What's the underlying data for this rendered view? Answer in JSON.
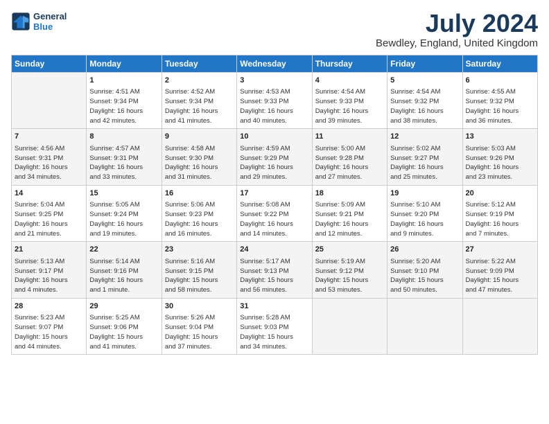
{
  "header": {
    "logo_line1": "General",
    "logo_line2": "Blue",
    "month": "July 2024",
    "location": "Bewdley, England, United Kingdom"
  },
  "weekdays": [
    "Sunday",
    "Monday",
    "Tuesday",
    "Wednesday",
    "Thursday",
    "Friday",
    "Saturday"
  ],
  "weeks": [
    [
      {
        "day": "",
        "info": ""
      },
      {
        "day": "1",
        "info": "Sunrise: 4:51 AM\nSunset: 9:34 PM\nDaylight: 16 hours\nand 42 minutes."
      },
      {
        "day": "2",
        "info": "Sunrise: 4:52 AM\nSunset: 9:34 PM\nDaylight: 16 hours\nand 41 minutes."
      },
      {
        "day": "3",
        "info": "Sunrise: 4:53 AM\nSunset: 9:33 PM\nDaylight: 16 hours\nand 40 minutes."
      },
      {
        "day": "4",
        "info": "Sunrise: 4:54 AM\nSunset: 9:33 PM\nDaylight: 16 hours\nand 39 minutes."
      },
      {
        "day": "5",
        "info": "Sunrise: 4:54 AM\nSunset: 9:32 PM\nDaylight: 16 hours\nand 38 minutes."
      },
      {
        "day": "6",
        "info": "Sunrise: 4:55 AM\nSunset: 9:32 PM\nDaylight: 16 hours\nand 36 minutes."
      }
    ],
    [
      {
        "day": "7",
        "info": "Sunrise: 4:56 AM\nSunset: 9:31 PM\nDaylight: 16 hours\nand 34 minutes."
      },
      {
        "day": "8",
        "info": "Sunrise: 4:57 AM\nSunset: 9:31 PM\nDaylight: 16 hours\nand 33 minutes."
      },
      {
        "day": "9",
        "info": "Sunrise: 4:58 AM\nSunset: 9:30 PM\nDaylight: 16 hours\nand 31 minutes."
      },
      {
        "day": "10",
        "info": "Sunrise: 4:59 AM\nSunset: 9:29 PM\nDaylight: 16 hours\nand 29 minutes."
      },
      {
        "day": "11",
        "info": "Sunrise: 5:00 AM\nSunset: 9:28 PM\nDaylight: 16 hours\nand 27 minutes."
      },
      {
        "day": "12",
        "info": "Sunrise: 5:02 AM\nSunset: 9:27 PM\nDaylight: 16 hours\nand 25 minutes."
      },
      {
        "day": "13",
        "info": "Sunrise: 5:03 AM\nSunset: 9:26 PM\nDaylight: 16 hours\nand 23 minutes."
      }
    ],
    [
      {
        "day": "14",
        "info": "Sunrise: 5:04 AM\nSunset: 9:25 PM\nDaylight: 16 hours\nand 21 minutes."
      },
      {
        "day": "15",
        "info": "Sunrise: 5:05 AM\nSunset: 9:24 PM\nDaylight: 16 hours\nand 19 minutes."
      },
      {
        "day": "16",
        "info": "Sunrise: 5:06 AM\nSunset: 9:23 PM\nDaylight: 16 hours\nand 16 minutes."
      },
      {
        "day": "17",
        "info": "Sunrise: 5:08 AM\nSunset: 9:22 PM\nDaylight: 16 hours\nand 14 minutes."
      },
      {
        "day": "18",
        "info": "Sunrise: 5:09 AM\nSunset: 9:21 PM\nDaylight: 16 hours\nand 12 minutes."
      },
      {
        "day": "19",
        "info": "Sunrise: 5:10 AM\nSunset: 9:20 PM\nDaylight: 16 hours\nand 9 minutes."
      },
      {
        "day": "20",
        "info": "Sunrise: 5:12 AM\nSunset: 9:19 PM\nDaylight: 16 hours\nand 7 minutes."
      }
    ],
    [
      {
        "day": "21",
        "info": "Sunrise: 5:13 AM\nSunset: 9:17 PM\nDaylight: 16 hours\nand 4 minutes."
      },
      {
        "day": "22",
        "info": "Sunrise: 5:14 AM\nSunset: 9:16 PM\nDaylight: 16 hours\nand 1 minute."
      },
      {
        "day": "23",
        "info": "Sunrise: 5:16 AM\nSunset: 9:15 PM\nDaylight: 15 hours\nand 58 minutes."
      },
      {
        "day": "24",
        "info": "Sunrise: 5:17 AM\nSunset: 9:13 PM\nDaylight: 15 hours\nand 56 minutes."
      },
      {
        "day": "25",
        "info": "Sunrise: 5:19 AM\nSunset: 9:12 PM\nDaylight: 15 hours\nand 53 minutes."
      },
      {
        "day": "26",
        "info": "Sunrise: 5:20 AM\nSunset: 9:10 PM\nDaylight: 15 hours\nand 50 minutes."
      },
      {
        "day": "27",
        "info": "Sunrise: 5:22 AM\nSunset: 9:09 PM\nDaylight: 15 hours\nand 47 minutes."
      }
    ],
    [
      {
        "day": "28",
        "info": "Sunrise: 5:23 AM\nSunset: 9:07 PM\nDaylight: 15 hours\nand 44 minutes."
      },
      {
        "day": "29",
        "info": "Sunrise: 5:25 AM\nSunset: 9:06 PM\nDaylight: 15 hours\nand 41 minutes."
      },
      {
        "day": "30",
        "info": "Sunrise: 5:26 AM\nSunset: 9:04 PM\nDaylight: 15 hours\nand 37 minutes."
      },
      {
        "day": "31",
        "info": "Sunrise: 5:28 AM\nSunset: 9:03 PM\nDaylight: 15 hours\nand 34 minutes."
      },
      {
        "day": "",
        "info": ""
      },
      {
        "day": "",
        "info": ""
      },
      {
        "day": "",
        "info": ""
      }
    ]
  ]
}
